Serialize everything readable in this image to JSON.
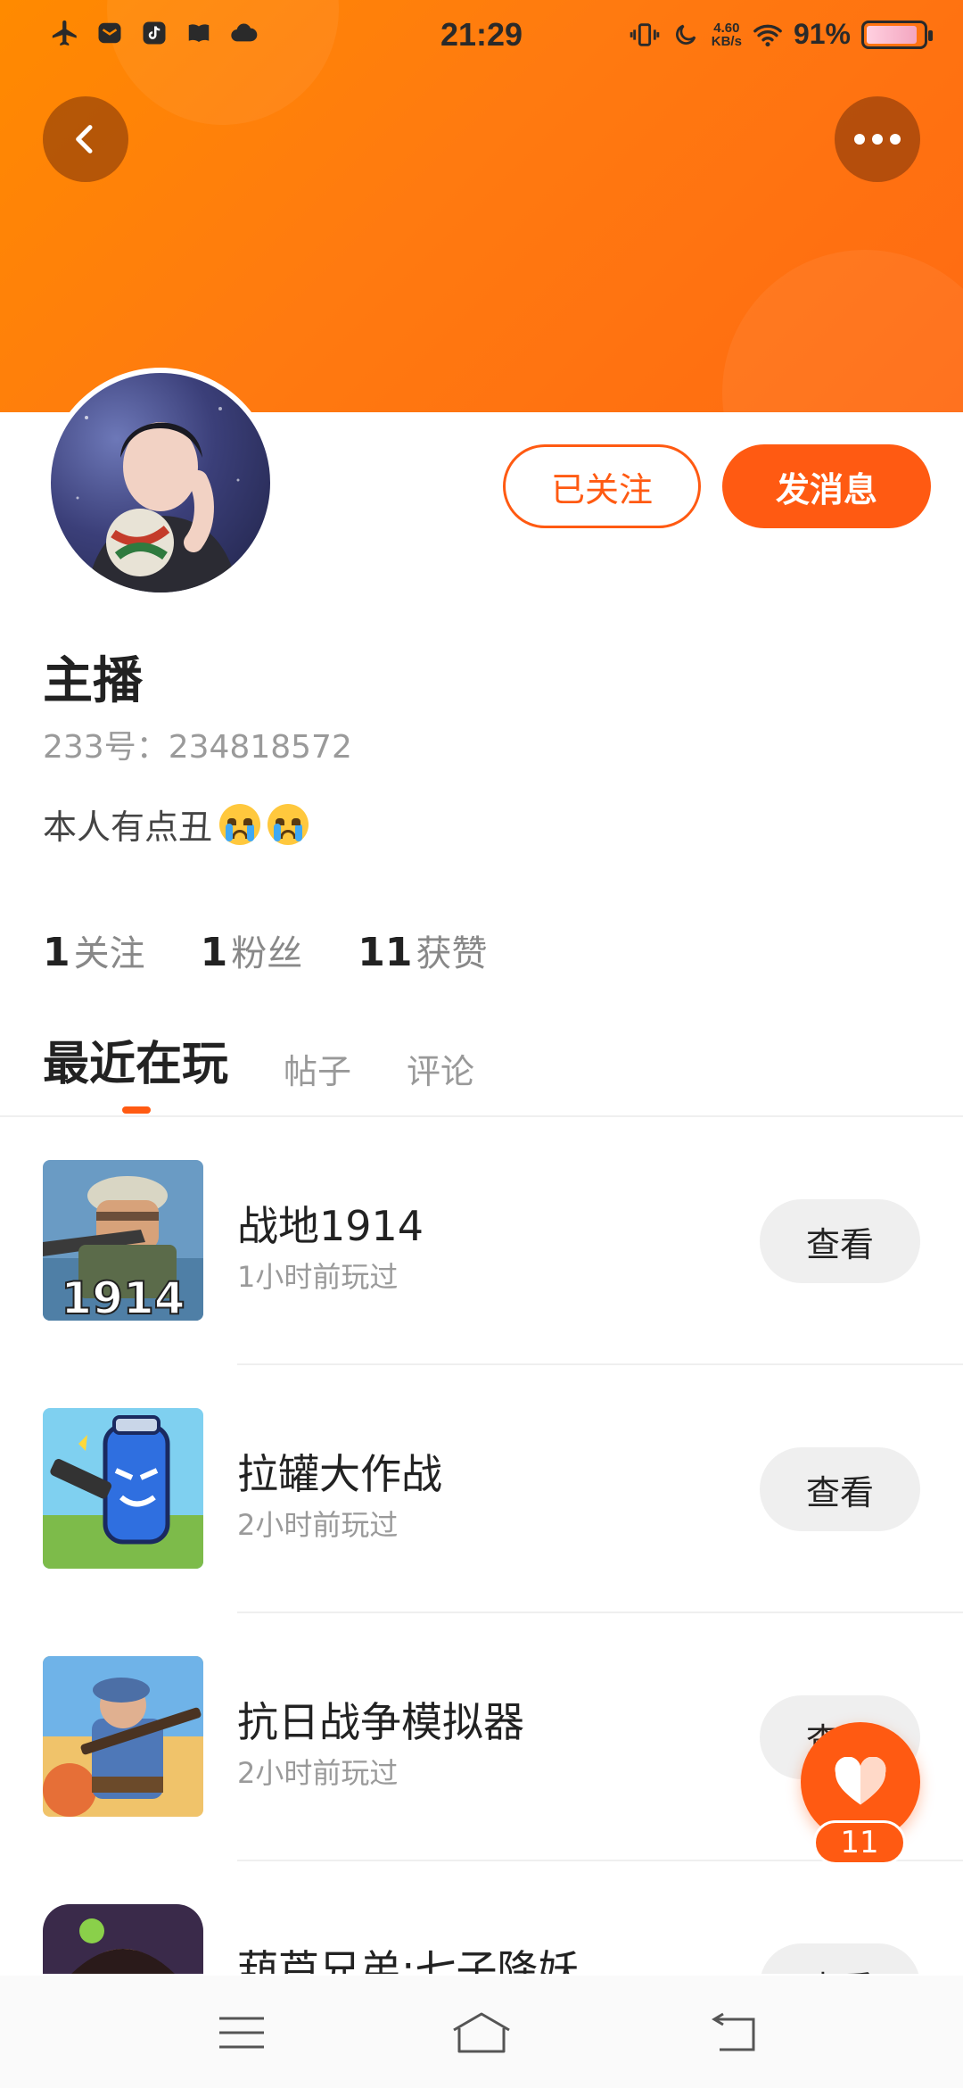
{
  "status_bar": {
    "time": "21:29",
    "net_speed_value": "4.60",
    "net_speed_unit": "KB/s",
    "battery": "91%",
    "battery_level": 0.91
  },
  "header": {
    "back_icon": "chevron-left-icon",
    "more_icon": "more-horizontal-icon",
    "accent_color": "#ff5a12"
  },
  "profile": {
    "follow_label": "已关注",
    "message_label": "发消息",
    "name": "主播",
    "uid": "233号：234818572",
    "bio_text": "本人有点丑",
    "bio_emojis": [
      "loudly-crying-face",
      "loudly-crying-face"
    ]
  },
  "stats": [
    {
      "num": "1",
      "label": "关注"
    },
    {
      "num": "1",
      "label": "粉丝"
    },
    {
      "num": "11",
      "label": "获赞"
    }
  ],
  "tabs": [
    "最近在玩",
    "帖子",
    "评论"
  ],
  "games": [
    {
      "title": "战地1914",
      "sub": "1小时前玩过",
      "button": "查看",
      "thumb_text": "1914"
    },
    {
      "title": "拉罐大作战",
      "sub": "2小时前玩过",
      "button": "查看"
    },
    {
      "title": "抗日战争模拟器",
      "sub": "2小时前玩过",
      "button": "查看"
    },
    {
      "title": "葫芦兄弟:七子降妖",
      "sub": "",
      "button": "查看"
    }
  ],
  "like": {
    "count": "11",
    "icon": "heart-icon"
  },
  "nav": {
    "menu_icon": "menu-icon",
    "home_icon": "home-icon",
    "back_icon": "back-arrow-icon"
  }
}
